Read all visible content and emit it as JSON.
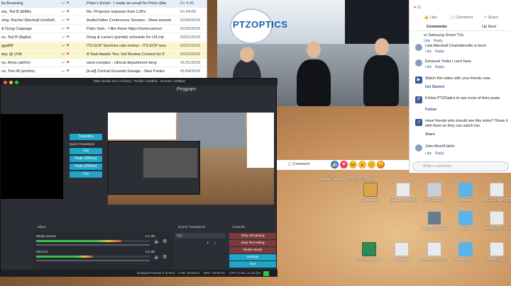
{
  "emails": [
    {
      "sender": "lla Browning",
      "subject": "Peter's Email - I made an email for Peter (like",
      "date": "Fri 4:36",
      "flag": false
    },
    {
      "sender": "ela, Ted B (lb8lb)",
      "subject": "Re: Projector requests from LSPs",
      "date": "Fri 04:05",
      "flag": false
    },
    {
      "sender": "ving, Rachel Marshall (om8wf)",
      "subject": "Audio/Video Conference Session - Www.samsel",
      "date": "03/26/2019",
      "flag": false
    },
    {
      "sender": "& Doug Cappage",
      "subject": "Patio Sets - I like these https://www.samscl",
      "date": "03/25/2019",
      "flag": false
    },
    {
      "sender": "ev, Ted B (lbg4a)",
      "subject": "Doug & Leela's (partial) schedule for US trip",
      "date": "03/21/2019",
      "flag": false
    },
    {
      "sender": "ggsBill",
      "subject": "ITS ECP Services rate review - ITS ECP wou",
      "date": "03/21/2019",
      "flag": true
    },
    {
      "sender": "day @ UVA",
      "subject": "A Task Awaits You: Set Review Contest for F",
      "date": "03/20/2019",
      "flag": true
    },
    {
      "sender": "ns, Anna (ad2m)",
      "subject": "west complex - clinical department wing",
      "date": "01/31/2019",
      "flag": true
    },
    {
      "sender": "ns, Tom M (amhtiz)",
      "subject": "[it-all] Central Grounds Garage - New Parkin",
      "date": "01/04/2019",
      "flag": false
    }
  ],
  "video": {
    "logo_text": "PTZOPTICS"
  },
  "facebook": {
    "likes_count": "21",
    "like_label": "Like",
    "comment_label": "Comment",
    "share_label": "Share",
    "comments_header": "Comments",
    "up_next_label": "Up Next",
    "comment_0_text": "or Samsung Smart TVs.",
    "comment_0_like": "Like",
    "comment_0_reply": "Reply",
    "comment_1_text": "Lela Marshall Charlottesville is here!",
    "comment_1_like": "Like",
    "comment_1_reply": "Reply",
    "comment_2_text": "Emanuel Yoder I can't hear.",
    "comment_2_like": "Like",
    "comment_2_reply": "Reply",
    "prompt_1": "Watch this video with your friends now.",
    "prompt_1_action": "Get Started",
    "prompt_2": "Follow PTZOptics to see more of their posts.",
    "prompt_2_action": "Follow",
    "prompt_3": "Have friends who should see this video? Share it with them so they can watch too.",
    "prompt_3_action": "Share",
    "comment_3_text": "John Morrill Hello",
    "comment_3_like": "Like",
    "comment_3_reply": "Reply",
    "write_comment_placeholder": "Write a comment..."
  },
  "comment_bar": {
    "comment_label": "Comment"
  },
  "obs": {
    "title": "OBS Studio 23.1.0 (mac) - Profile: Untitled - Scenes: Untitled",
    "program_label": "Program",
    "transition_button": "Transition",
    "quick_transitions_label": "Quick Transitions",
    "transitions": [
      "Cut",
      "Fade (300ms)",
      "Fade (300ms)",
      "Cut"
    ],
    "mixer_title": "Mixer",
    "scene_transitions_title": "Scene Transitions",
    "controls_title": "Controls",
    "transition_select": "Cut",
    "mixer_sources": [
      {
        "name": "Media Source",
        "db": "0.0 dB"
      },
      {
        "name": "Mic/Aux",
        "db": "0.0 dB"
      }
    ],
    "controls": [
      "Stop Streaming",
      "Stop Recording",
      "Studio Mode",
      "Settings",
      "Exit"
    ],
    "status": {
      "dropped": "Dropped Frames 0 (0.0%)",
      "live": "LIVE: 00:00:01",
      "rec": "REC: 00:00:01",
      "cpu": "CPU: 5.4%, 21.64 fps"
    }
  },
  "desktop_icons": [
    {
      "label": "Catalog...ical.txt",
      "type": "file"
    },
    {
      "label": "2019-05...PM.png",
      "type": "file"
    },
    {
      "label": "Zoom.pkg",
      "type": "file"
    },
    {
      "label": "EquipDB Design (dragged) 2.pdf",
      "type": "file"
    },
    {
      "label": "mm 110.png",
      "type": "file"
    },
    {
      "label": "solstice",
      "type": "folder"
    },
    {
      "label": "NAU101-IMPORT.csv",
      "type": "file"
    },
    {
      "label": "w8325 copy.jpg",
      "type": "file"
    },
    {
      "label": "temp",
      "type": "folder"
    },
    {
      "label": "tenfold2.5.1.zip",
      "type": "file"
    },
    {
      "label": "ti_rca copy.pub",
      "type": "file"
    },
    {
      "label": "edge.png",
      "type": "file"
    },
    {
      "label": "43494141 4_2019 0311_083008.wav",
      "type": "file"
    },
    {
      "label": "untitled folder",
      "type": "folder"
    },
    {
      "label": "40095.png",
      "type": "file"
    }
  ]
}
